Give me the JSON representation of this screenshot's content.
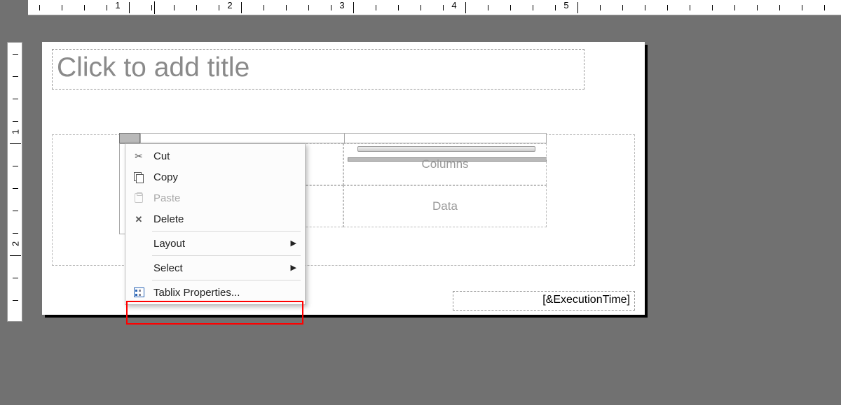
{
  "ruler_h": {
    "majors": [
      "1",
      "2",
      "3",
      "4",
      "5"
    ]
  },
  "ruler_v": {
    "majors": [
      "1",
      "2"
    ]
  },
  "title_placeholder": "Click to add title",
  "footer_expression": "[&ExecutionTime]",
  "tablix": {
    "columns_label": "Columns",
    "data_label": "Data"
  },
  "context_menu": {
    "cut": "Cut",
    "copy": "Copy",
    "paste": "Paste",
    "delete": "Delete",
    "layout": "Layout",
    "select": "Select",
    "tablix_properties": "Tablix Properties..."
  }
}
